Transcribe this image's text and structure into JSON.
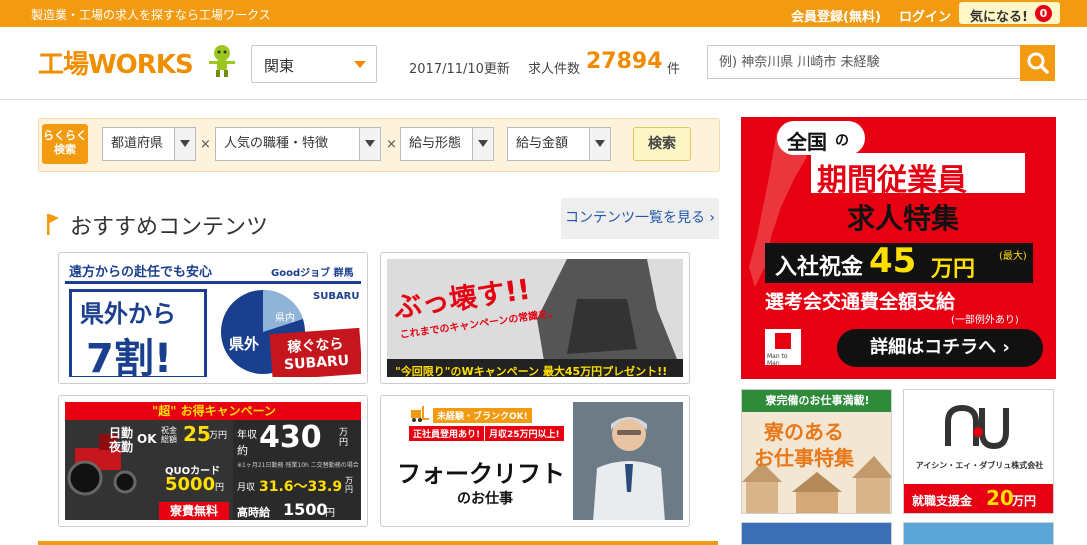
{
  "topbar": {
    "tagline": "製造業・工場の求人を探すなら工場ワークス",
    "register": "会員登録(無料)",
    "login": "ログイン",
    "favorites_label": "気になる!",
    "favorites_count": "0"
  },
  "header": {
    "logo_text": "工場WORKS",
    "region_value": "関東",
    "updated": "2017/11/10更新",
    "jobs_label": "求人件数",
    "jobs_count": "27894",
    "jobs_unit": "件",
    "search_placeholder": "例) 神奈川県 川崎市 未経験"
  },
  "quick_search": {
    "tag": "らくらく検索",
    "tag_line1": "らくらく",
    "tag_line2": "検索",
    "prefecture": "都道府県",
    "occupation": "人気の職種・特徴",
    "pay_type": "給与形態",
    "pay_amount": "給与金額",
    "times": "×",
    "search_button": "検索"
  },
  "recommended": {
    "title": "おすすめコンテンツ",
    "more": "コンテンツ一覧を見る"
  },
  "cards": [
    {
      "headline": "遠方からの赴任でも安心",
      "brand": "Goodジョブ 群馬",
      "big1": "県外から",
      "big2": "7割!",
      "pie_out": "県外",
      "pie_in": "県内",
      "logo": "SUBARU",
      "slogan1": "稼ぐなら",
      "slogan2": "SUBARU"
    },
    {
      "headline": "ぶっ壊す!!",
      "sub": "これまでのキャンペーンの常識を。",
      "footer": "\"今回限り\"のWキャンペーン 最大45万円プレゼント!!"
    },
    {
      "headline": "\"超\" お得キャンペーン",
      "l1": "日勤",
      "l2": "夜勤",
      "ok": "OK",
      "bonus_label": "祝金総額",
      "bonus": "25",
      "bonus_unit": "万円",
      "annual_label": "年収",
      "annual_prefix": "約",
      "annual": "430",
      "annual_unit": "万円",
      "note": "※1ヶ月21日勤務 残業10h 二交替勤務の場合",
      "quo": "QUOカード",
      "quo_amount": "5000",
      "quo_unit": "円",
      "monthly_label": "月収",
      "monthly": "31.6～33.9",
      "monthly_unit": "万円",
      "dorm": "寮費無料",
      "hourly_label": "高時給",
      "hourly": "1500",
      "hourly_unit": "円"
    },
    {
      "tag1": "未経験・ブランクOK!",
      "tag2": "正社員登用あり!",
      "tag3": "月収25万円以上!",
      "title": "フォークリフト",
      "sub": "のお仕事"
    }
  ],
  "right_banner": {
    "l1a": "全国",
    "l1b": "の",
    "l2": "期間従業員",
    "l3": "求人特集",
    "bonus_pre": "入社祝金",
    "bonus": "45",
    "bonus_unit": "万円",
    "max_note": "(最大)",
    "l5": "選考会交通費全額支給",
    "l5_note": "(一部例外あり)",
    "cta": "詳細はコチラへ",
    "badge": "Man to Man"
  },
  "small_ads": [
    {
      "headline": "寮完備のお仕事満載!",
      "big1": "寮のある",
      "big2": "お仕事特集"
    },
    {
      "company": "アイシン・エィ・ダブリュ株式会社",
      "bottom_pre": "就職支援金",
      "bottom_amount": "20",
      "bottom_unit": "万円"
    }
  ],
  "colors": {
    "accent": "#f29b11",
    "red": "#e60012",
    "link": "#2059a8"
  }
}
